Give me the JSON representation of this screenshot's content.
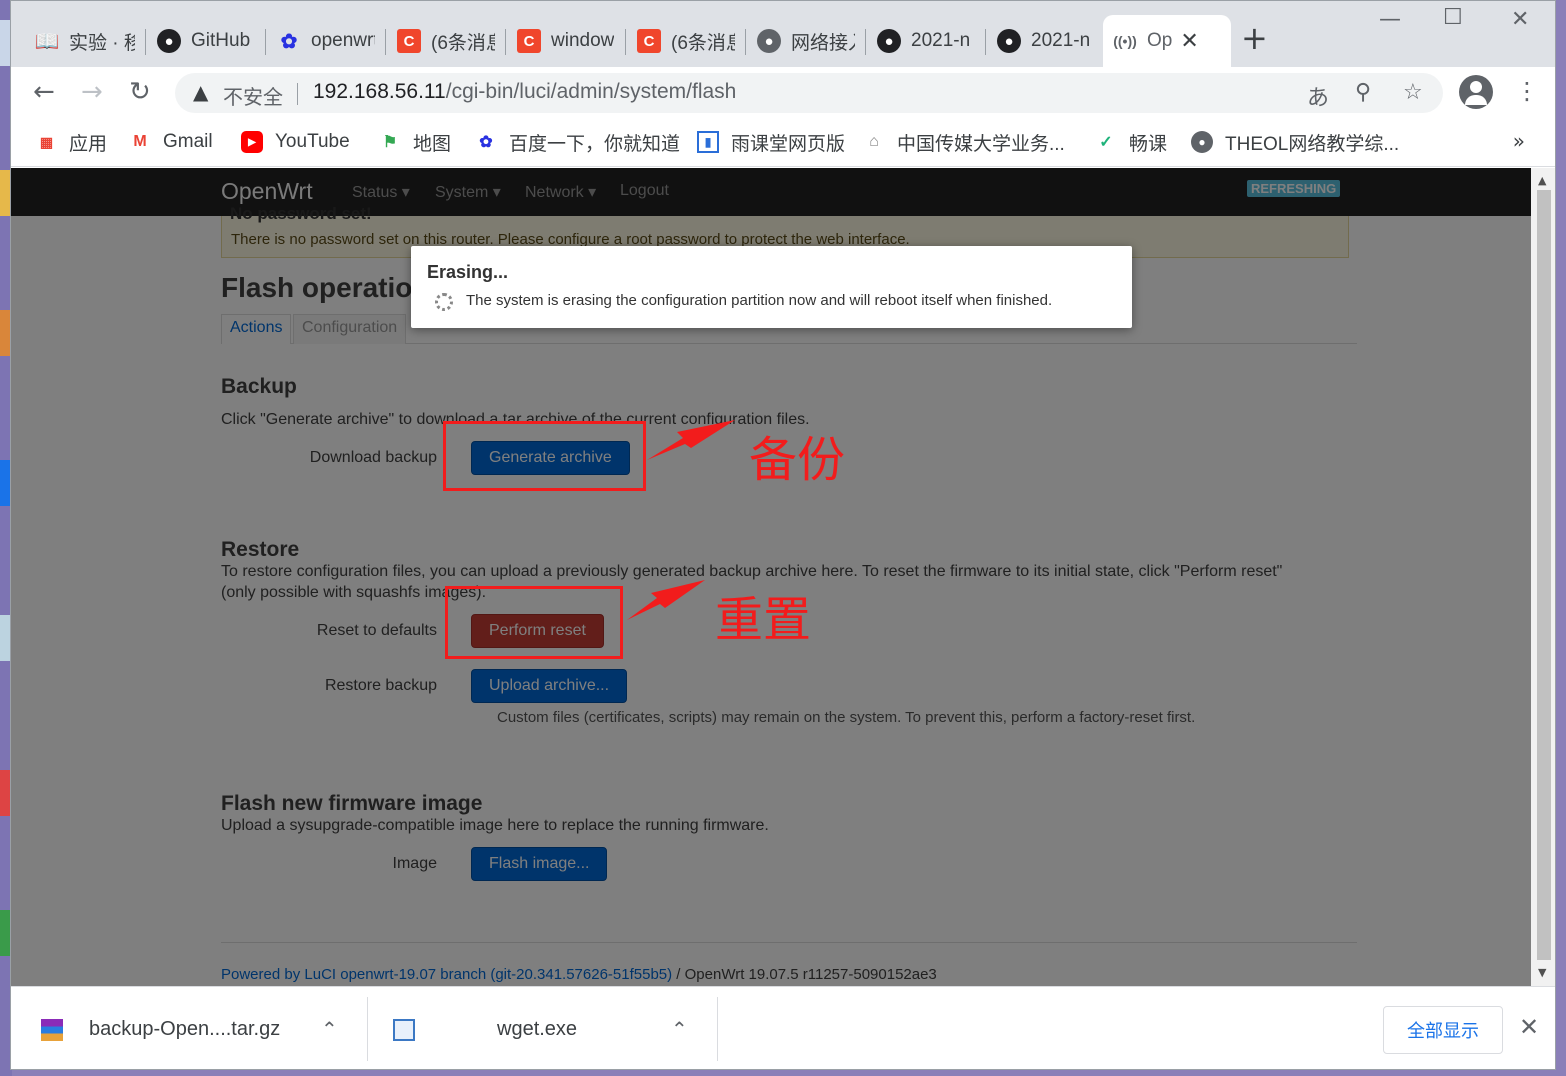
{
  "tabs": [
    {
      "label": "实验 · 移",
      "icon": "book-icon",
      "color": "#3c4043"
    },
    {
      "label": "GitHub",
      "icon": "github-icon",
      "color": "#202124"
    },
    {
      "label": "openwrt",
      "icon": "baidu-icon",
      "color": "#2932e1"
    },
    {
      "label": "(6条消息",
      "icon": "csdn-icon",
      "color": "#f0462c"
    },
    {
      "label": "window",
      "icon": "csdn-icon",
      "color": "#f0462c"
    },
    {
      "label": "(6条消息",
      "icon": "csdn-icon",
      "color": "#f0462c"
    },
    {
      "label": "网络接入",
      "icon": "globe-icon",
      "color": "#5f6368"
    },
    {
      "label": "2021-n",
      "icon": "github-icon",
      "color": "#202124"
    },
    {
      "label": "2021-n",
      "icon": "github-icon",
      "color": "#202124"
    },
    {
      "label": "Op",
      "icon": "broadcast-icon",
      "color": "#5f6368",
      "active": true
    }
  ],
  "address": {
    "insecure_label": "不安全",
    "host": "192.168.56.11",
    "path": "/cgi-bin/luci/admin/system/flash"
  },
  "bookmarks": [
    {
      "label": "应用",
      "icon": "apps-grid-icon"
    },
    {
      "label": "Gmail",
      "icon": "gmail-icon"
    },
    {
      "label": "YouTube",
      "icon": "youtube-icon"
    },
    {
      "label": "地图",
      "icon": "maps-icon"
    },
    {
      "label": "百度一下，你就知道",
      "icon": "baidu-icon"
    },
    {
      "label": "雨课堂网页版",
      "icon": "yuketang-icon"
    },
    {
      "label": "中国传媒大学业务...",
      "icon": "home-icon"
    },
    {
      "label": "畅课",
      "icon": "changke-icon"
    },
    {
      "label": "THEOL网络教学综...",
      "icon": "theol-icon"
    }
  ],
  "openwrt": {
    "brand": "OpenWrt",
    "menu": [
      "Status",
      "System",
      "Network",
      "Logout"
    ],
    "badge": "REFRESHING"
  },
  "alert": {
    "heading": "No password set!",
    "text": "There is no password set on this router. Please configure a root password to protect the web interface."
  },
  "page": {
    "title": "Flash operations",
    "tabs": [
      "Actions",
      "Configuration"
    ],
    "backup": {
      "heading": "Backup",
      "desc": "Click \"Generate archive\" to download a tar archive of the current configuration files.",
      "label": "Download backup",
      "button": "Generate archive"
    },
    "restore": {
      "heading": "Restore",
      "desc": "To restore configuration files, you can upload a previously generated backup archive here. To reset the firmware to its initial state, click \"Perform reset\" (only possible with squashfs images).",
      "reset_label": "Reset to defaults",
      "reset_button": "Perform reset",
      "restore_label": "Restore backup",
      "restore_button": "Upload archive...",
      "note": "Custom files (certificates, scripts) may remain on the system. To prevent this, perform a factory-reset first."
    },
    "flash": {
      "heading": "Flash new firmware image",
      "desc": "Upload a sysupgrade-compatible image here to replace the running firmware.",
      "label": "Image",
      "button": "Flash image..."
    },
    "footer_link": "Powered by LuCI openwrt-19.07 branch (git-20.341.57626-51f55b5)",
    "footer_rest": " / OpenWrt 19.07.5 r11257-5090152ae3"
  },
  "modal": {
    "title": "Erasing...",
    "text": "The system is erasing the configuration partition now and will reboot itself when finished."
  },
  "annotations": {
    "backup": "备份",
    "reset": "重置"
  },
  "downloads": [
    {
      "name": "backup-Open....tar.gz",
      "icon": "archive-icon"
    },
    {
      "name": "wget.exe",
      "icon": "exe-icon"
    }
  ],
  "downloads_show_all": "全部显示"
}
